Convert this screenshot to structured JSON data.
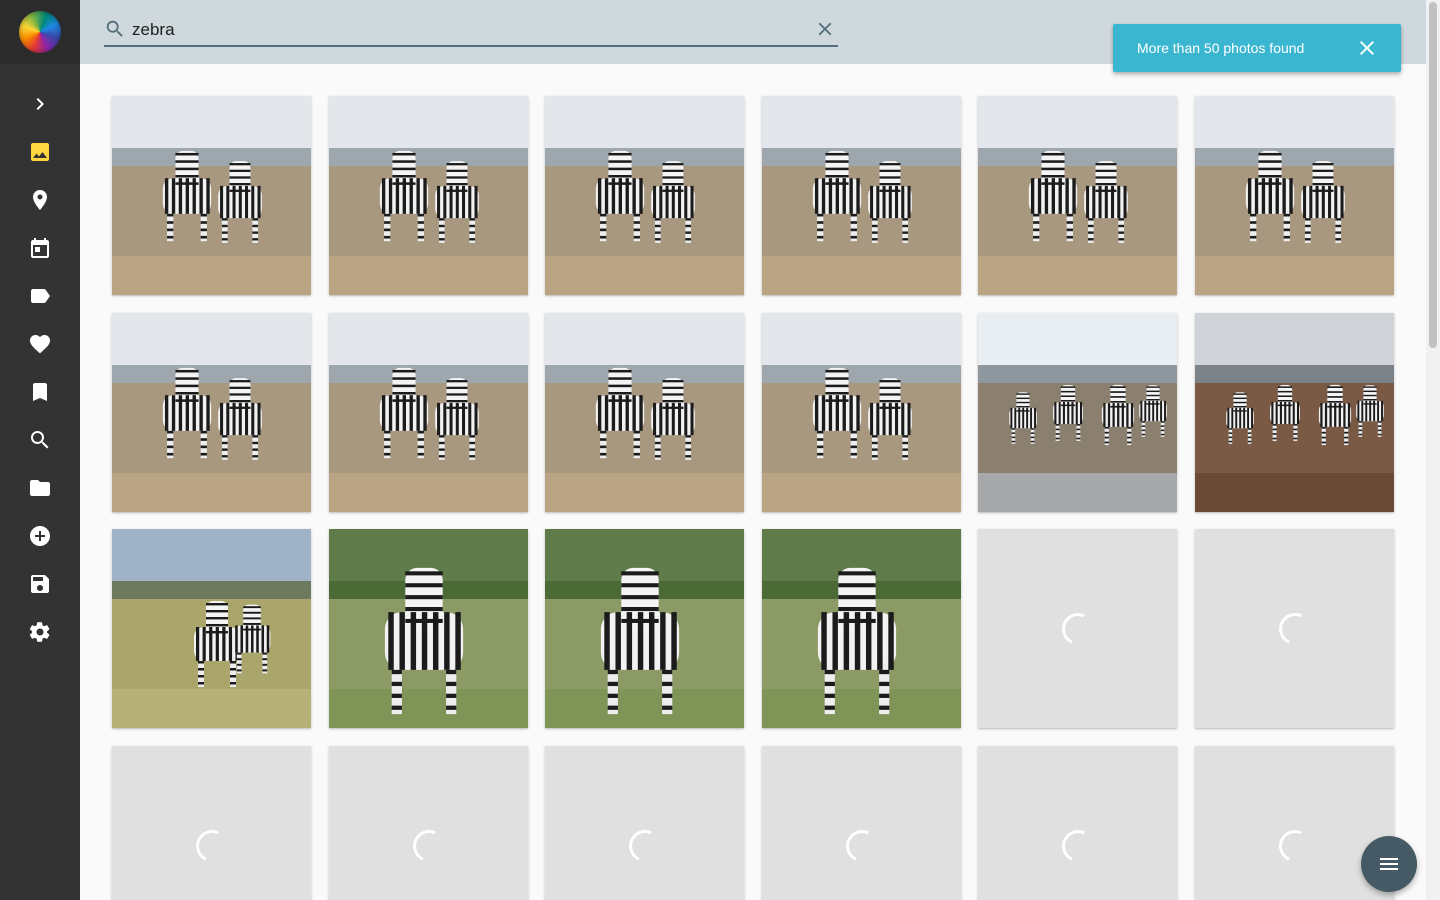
{
  "search": {
    "value": "zebra",
    "placeholder": "Search"
  },
  "notification": {
    "message": "More than 50 photos found"
  },
  "sidebar": {
    "items": [
      {
        "icon": "chevron-right-icon",
        "name": "expand"
      },
      {
        "icon": "image-icon",
        "name": "photos",
        "active": true
      },
      {
        "icon": "place-icon",
        "name": "places"
      },
      {
        "icon": "calendar-icon",
        "name": "calendar"
      },
      {
        "icon": "label-icon",
        "name": "labels"
      },
      {
        "icon": "heart-icon",
        "name": "favorites"
      },
      {
        "icon": "bookmark-icon",
        "name": "albums"
      },
      {
        "icon": "search-icon",
        "name": "search"
      },
      {
        "icon": "folder-icon",
        "name": "folders"
      },
      {
        "icon": "add-circle-icon",
        "name": "import"
      },
      {
        "icon": "save-icon",
        "name": "save"
      },
      {
        "icon": "settings-icon",
        "name": "settings"
      }
    ]
  },
  "photos": [
    {
      "scene": "savanna-cloudy",
      "state": "loaded"
    },
    {
      "scene": "savanna-cloudy",
      "state": "loaded"
    },
    {
      "scene": "savanna-cloudy",
      "state": "loaded"
    },
    {
      "scene": "savanna-cloudy",
      "state": "loaded"
    },
    {
      "scene": "savanna-cloudy",
      "state": "loaded"
    },
    {
      "scene": "savanna-cloudy",
      "state": "loaded"
    },
    {
      "scene": "savanna-cloudy",
      "state": "loaded"
    },
    {
      "scene": "savanna-cloudy",
      "state": "loaded"
    },
    {
      "scene": "savanna-cloudy",
      "state": "loaded"
    },
    {
      "scene": "savanna-cloudy",
      "state": "loaded"
    },
    {
      "scene": "herd-road",
      "state": "loaded"
    },
    {
      "scene": "herd-dusk",
      "state": "loaded"
    },
    {
      "scene": "grassland-pair",
      "state": "loaded"
    },
    {
      "scene": "green-bush",
      "state": "loaded"
    },
    {
      "scene": "green-bush",
      "state": "loaded"
    },
    {
      "scene": "green-bush",
      "state": "loaded"
    },
    {
      "scene": "",
      "state": "loading"
    },
    {
      "scene": "",
      "state": "loading"
    },
    {
      "scene": "",
      "state": "loading"
    },
    {
      "scene": "",
      "state": "loading"
    },
    {
      "scene": "",
      "state": "loading"
    },
    {
      "scene": "",
      "state": "loading"
    },
    {
      "scene": "",
      "state": "loading"
    },
    {
      "scene": "",
      "state": "loading"
    }
  ],
  "colors": {
    "sidebar": "#333333",
    "topbar": "#cfd8dc",
    "active_icon": "#ffd740",
    "notification": "#3ab6d0",
    "fab": "#455a64"
  }
}
